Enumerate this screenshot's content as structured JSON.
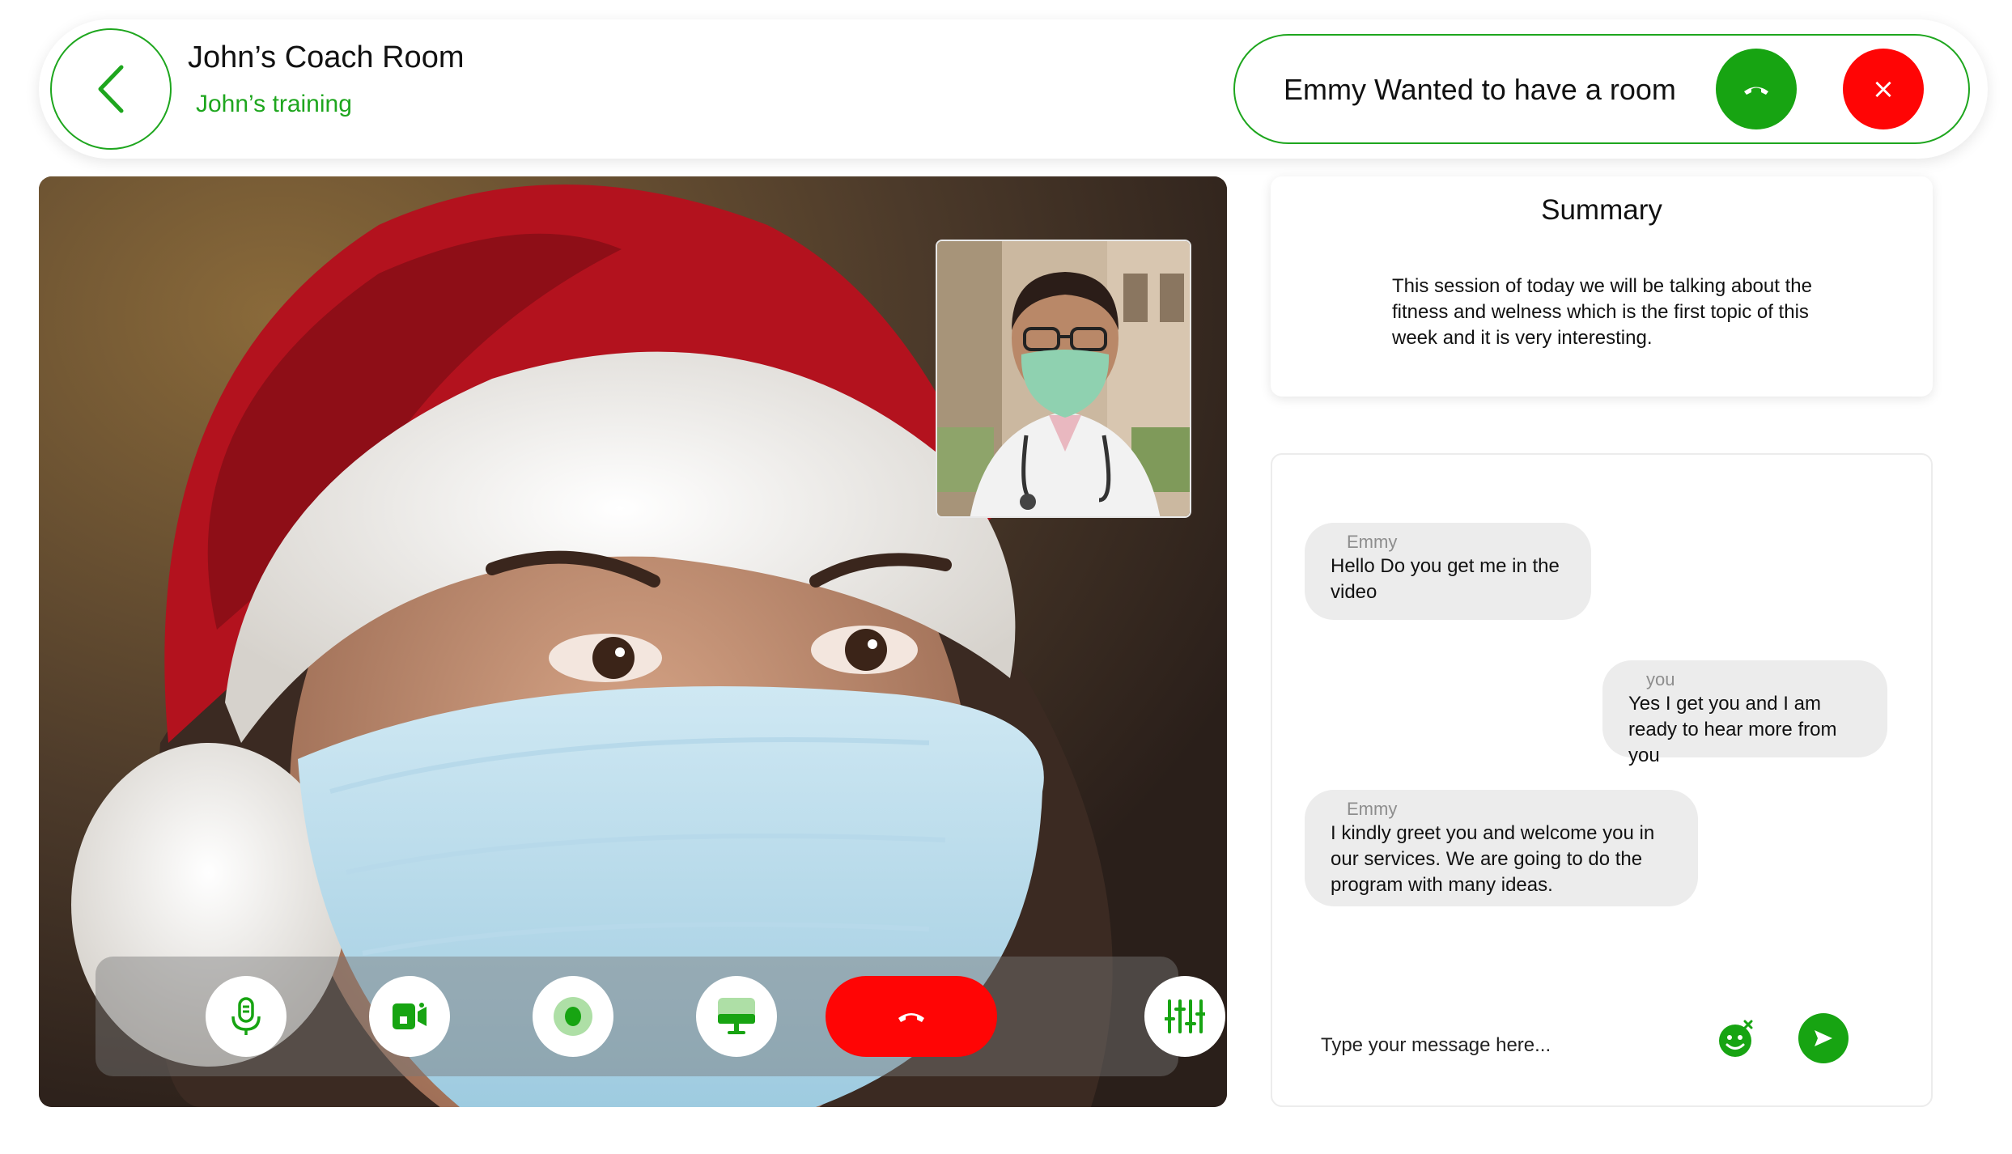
{
  "header": {
    "title": "John’s Coach Room",
    "subtitle": "John’s training",
    "back_icon": "chevron-left-icon"
  },
  "incoming_call": {
    "text": "Emmy Wanted to have a room",
    "accept_icon": "phone-accept-icon",
    "decline_icon": "close-icon",
    "decline_glyph": "×"
  },
  "video": {
    "controls": [
      {
        "name": "microphone-icon"
      },
      {
        "name": "video-camera-icon"
      },
      {
        "name": "record-icon"
      },
      {
        "name": "screen-share-icon"
      },
      {
        "name": "end-call-icon"
      },
      {
        "name": "settings-sliders-icon"
      }
    ]
  },
  "summary": {
    "title": "Summary",
    "text": "This session of today we will be talking about the fitness and welness which is the first topic of this week and it is very interesting."
  },
  "chat": {
    "messages": [
      {
        "sender": "Emmy",
        "text": "Hello Do you get me in the video"
      },
      {
        "sender": "you",
        "text": "Yes I get you and I am ready to hear more from you"
      },
      {
        "sender": "Emmy",
        "text": "I kindly greet you and welcome you in our services. We are going to do the program with many  ideas."
      }
    ],
    "input_placeholder": "Type your message here...",
    "emoji_icon": "emoji-icon",
    "send_icon": "send-icon"
  },
  "colors": {
    "accent_green": "#17a412",
    "danger_red": "#ff0505",
    "bubble_gray": "#ececec"
  }
}
